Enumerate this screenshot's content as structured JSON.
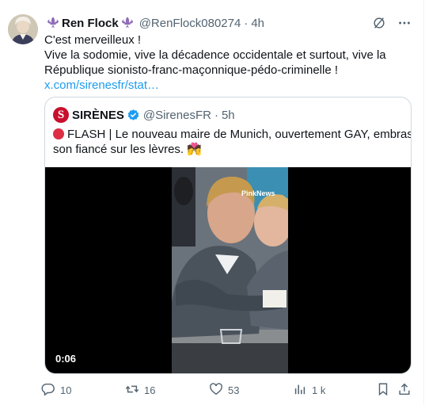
{
  "tweet": {
    "author_name": "Ren Flock",
    "author_handle": "@RenFlock080274",
    "separator": "·",
    "time": "4h",
    "lines": [
      "C'est merveilleux !",
      "Vive la sodomie, vive la décadence occidentale et surtout, vive la",
      "République sionisto-franc-maçonnique-pédo-criminelle !"
    ],
    "link": "x.com/sirenesfr/stat…"
  },
  "quote": {
    "name": "SIRÈNES",
    "handle": "@SirenesFR",
    "separator": "·",
    "time": "5h",
    "text_line1": "FLASH | Le nouveau maire de Munich, ouvertement GAY, embrasse",
    "text_line2": "son fiancé sur les lèvres. 💏",
    "logo_letter": "S",
    "video_time": "0:06",
    "watermark": "PinkNews"
  },
  "actions": {
    "replies": "10",
    "reposts": "16",
    "likes": "53",
    "views": "1 k"
  },
  "colors": {
    "accent": "#1d9bf0",
    "muted": "#536471",
    "border": "#cfd9de",
    "brand_red": "#c8102e",
    "fleur": "#8e6bb8"
  },
  "icons": [
    "fleur-de-lis-icon",
    "grok-icon",
    "more-icon",
    "verified-icon",
    "reply-icon",
    "repost-icon",
    "like-icon",
    "views-icon",
    "bookmark-icon",
    "share-icon"
  ]
}
